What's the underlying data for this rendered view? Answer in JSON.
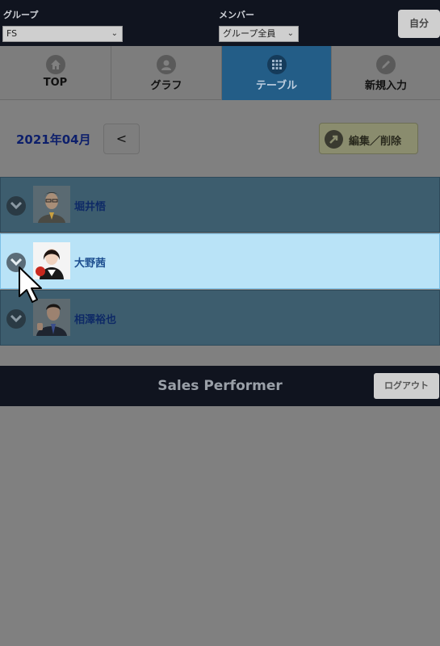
{
  "header": {
    "group_label": "グループ",
    "group_value": "FS",
    "member_label": "メンバー",
    "member_value": "グループ全員",
    "self_button": "自分"
  },
  "tabs": [
    {
      "label": "TOP",
      "icon": "home-icon"
    },
    {
      "label": "グラフ",
      "icon": "user-icon"
    },
    {
      "label": "テーブル",
      "icon": "grid-icon",
      "active": true
    },
    {
      "label": "新規入力",
      "icon": "pencil-icon"
    }
  ],
  "toolbar": {
    "month": "2021年04月",
    "prev_button": "<",
    "edit_button": "編集／削除"
  },
  "members": [
    {
      "name": "堀井悟",
      "selected": false
    },
    {
      "name": "大野茜",
      "selected": true
    },
    {
      "name": "相澤裕也",
      "selected": false
    }
  ],
  "footer": {
    "title": "Sales Performer",
    "logout_button": "ログアウト"
  },
  "colors": {
    "header_bg": "#10141f",
    "active_tab": "#235d87",
    "selected_row": "#b9e3f7",
    "row_bg": "#3d5d6e"
  }
}
